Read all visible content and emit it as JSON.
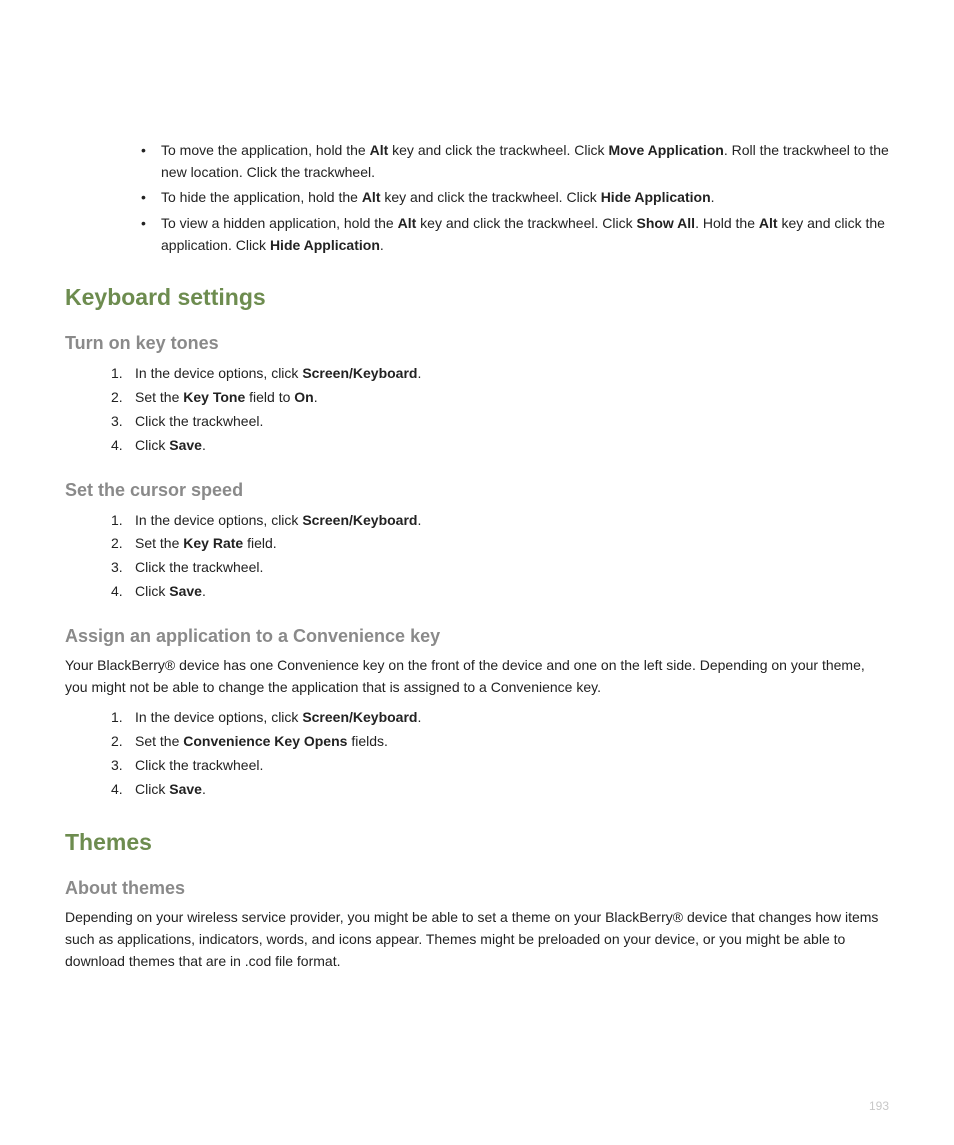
{
  "bullets": [
    {
      "segments": [
        {
          "t": "To move the application, hold the ",
          "b": false
        },
        {
          "t": "Alt",
          "b": true
        },
        {
          "t": " key and click the trackwheel. Click ",
          "b": false
        },
        {
          "t": "Move Application",
          "b": true
        },
        {
          "t": ". Roll the trackwheel to the new location. Click the trackwheel.",
          "b": false
        }
      ]
    },
    {
      "segments": [
        {
          "t": "To hide the application, hold the ",
          "b": false
        },
        {
          "t": "Alt",
          "b": true
        },
        {
          "t": " key and click the trackwheel. Click ",
          "b": false
        },
        {
          "t": "Hide Application",
          "b": true
        },
        {
          "t": ".",
          "b": false
        }
      ]
    },
    {
      "segments": [
        {
          "t": "To view a hidden application, hold the ",
          "b": false
        },
        {
          "t": "Alt",
          "b": true
        },
        {
          "t": " key and click the trackwheel. Click ",
          "b": false
        },
        {
          "t": "Show All",
          "b": true
        },
        {
          "t": ". Hold the ",
          "b": false
        },
        {
          "t": "Alt",
          "b": true
        },
        {
          "t": " key and click the application. Click ",
          "b": false
        },
        {
          "t": "Hide Application",
          "b": true
        },
        {
          "t": ".",
          "b": false
        }
      ]
    }
  ],
  "sections": {
    "keyboard": {
      "title": "Keyboard settings",
      "subs": {
        "keytones": {
          "title": "Turn on key tones",
          "steps": [
            [
              {
                "t": "In the device options, click ",
                "b": false
              },
              {
                "t": "Screen/Keyboard",
                "b": true
              },
              {
                "t": ".",
                "b": false
              }
            ],
            [
              {
                "t": "Set the ",
                "b": false
              },
              {
                "t": "Key Tone",
                "b": true
              },
              {
                "t": " field to ",
                "b": false
              },
              {
                "t": "On",
                "b": true
              },
              {
                "t": ".",
                "b": false
              }
            ],
            [
              {
                "t": "Click the trackwheel.",
                "b": false
              }
            ],
            [
              {
                "t": "Click ",
                "b": false
              },
              {
                "t": "Save",
                "b": true
              },
              {
                "t": ".",
                "b": false
              }
            ]
          ]
        },
        "cursor": {
          "title": "Set the cursor speed",
          "steps": [
            [
              {
                "t": "In the device options, click ",
                "b": false
              },
              {
                "t": "Screen/Keyboard",
                "b": true
              },
              {
                "t": ".",
                "b": false
              }
            ],
            [
              {
                "t": "Set the ",
                "b": false
              },
              {
                "t": "Key Rate",
                "b": true
              },
              {
                "t": " field.",
                "b": false
              }
            ],
            [
              {
                "t": "Click the trackwheel.",
                "b": false
              }
            ],
            [
              {
                "t": "Click ",
                "b": false
              },
              {
                "t": "Save",
                "b": true
              },
              {
                "t": ".",
                "b": false
              }
            ]
          ]
        },
        "convenience": {
          "title": "Assign an application to a Convenience key",
          "intro": "Your BlackBerry® device has one Convenience key on the front of the device and one on the left side. Depending on your theme, you might not be able to change the application that is assigned to a Convenience key.",
          "steps": [
            [
              {
                "t": "In the device options, click ",
                "b": false
              },
              {
                "t": "Screen/Keyboard",
                "b": true
              },
              {
                "t": ".",
                "b": false
              }
            ],
            [
              {
                "t": "Set the ",
                "b": false
              },
              {
                "t": "Convenience Key Opens",
                "b": true
              },
              {
                "t": " fields.",
                "b": false
              }
            ],
            [
              {
                "t": "Click the trackwheel.",
                "b": false
              }
            ],
            [
              {
                "t": "Click ",
                "b": false
              },
              {
                "t": "Save",
                "b": true
              },
              {
                "t": ".",
                "b": false
              }
            ]
          ]
        }
      }
    },
    "themes": {
      "title": "Themes",
      "subs": {
        "about": {
          "title": "About themes",
          "para": "Depending on your wireless service provider, you might be able to set a theme on your BlackBerry® device that changes how items such as applications, indicators, words, and icons appear. Themes might be preloaded on your device, or you might be able to download themes that are in .cod file format."
        }
      }
    }
  },
  "page_number": "193"
}
